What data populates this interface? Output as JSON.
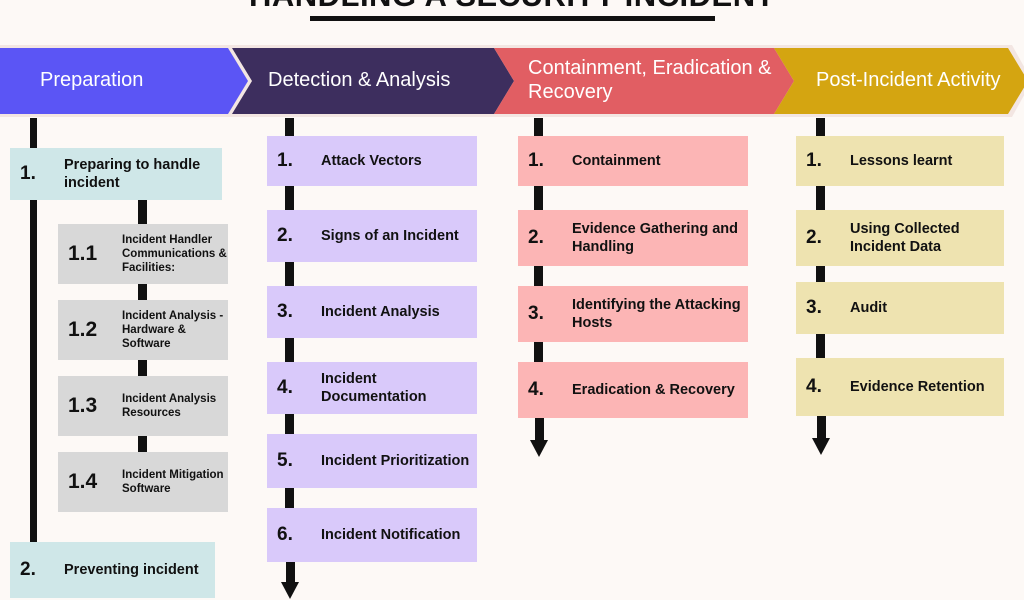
{
  "title": "HANDLING A SECURITY INCIDENT",
  "colors": {
    "background": "#fdf9f6",
    "banner_preparation": "#5b55f5",
    "banner_detection": "#3d2e5e",
    "banner_containment": "#e15e63",
    "banner_post_incident": "#d4a511",
    "box_phase1": "#cfe7e8",
    "box_phase1_sub": "#d8d8d8",
    "box_phase2": "#d9c9fa",
    "box_phase3": "#fcb5b5",
    "box_phase4": "#eee3b0",
    "connector": "#111111"
  },
  "phases": [
    {
      "banner_label": "Preparation",
      "banner_color": "#5b55f5",
      "steps": [
        {
          "number": "1.",
          "label": "Preparing to handle incident"
        },
        {
          "number": "2.",
          "label": "Preventing incident"
        }
      ],
      "substeps": [
        {
          "number": "1.1",
          "label": "Incident Handler Communications & Facilities:"
        },
        {
          "number": "1.2",
          "label": "Incident Analysis - Hardware & Software"
        },
        {
          "number": "1.3",
          "label": "Incident Analysis Resources"
        },
        {
          "number": "1.4",
          "label": "Incident Mitigation Software"
        }
      ]
    },
    {
      "banner_label": "Detection & Analysis",
      "banner_color": "#3d2e5e",
      "steps": [
        {
          "number": "1.",
          "label": "Attack Vectors"
        },
        {
          "number": "2.",
          "label": "Signs of an Incident"
        },
        {
          "number": "3.",
          "label": "Incident Analysis"
        },
        {
          "number": "4.",
          "label": "Incident Documentation"
        },
        {
          "number": "5.",
          "label": "Incident Prioritization"
        },
        {
          "number": "6.",
          "label": "Incident Notification"
        }
      ],
      "substeps": []
    },
    {
      "banner_label": "Containment, Eradication & Recovery",
      "banner_color": "#e15e63",
      "steps": [
        {
          "number": "1.",
          "label": "Containment"
        },
        {
          "number": "2.",
          "label": "Evidence Gathering and Handling"
        },
        {
          "number": "3.",
          "label": "Identifying the Attacking Hosts"
        },
        {
          "number": "4.",
          "label": "Eradication & Recovery"
        }
      ],
      "substeps": []
    },
    {
      "banner_label": "Post-Incident Activity",
      "banner_color": "#d4a511",
      "steps": [
        {
          "number": "1.",
          "label": "Lessons learnt"
        },
        {
          "number": "2.",
          "label": "Using Collected Incident Data"
        },
        {
          "number": "3.",
          "label": "Audit"
        },
        {
          "number": "4.",
          "label": "Evidence Retention"
        }
      ],
      "substeps": []
    }
  ]
}
